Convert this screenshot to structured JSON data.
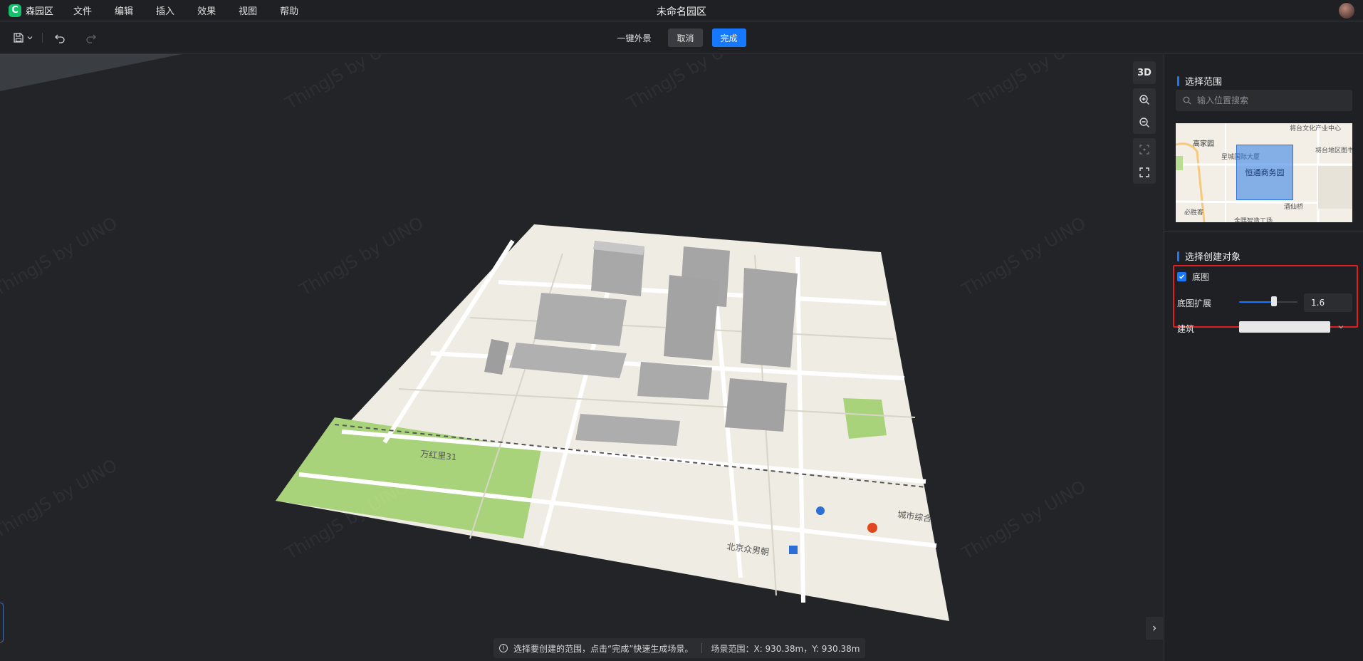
{
  "app": {
    "name": "森园区",
    "logo_letter": "C",
    "window_title": "未命名园区"
  },
  "menu": [
    "文件",
    "编辑",
    "插入",
    "效果",
    "视图",
    "帮助"
  ],
  "toolbar": {
    "one_click_label": "一键外景",
    "cancel_label": "取消",
    "done_label": "完成"
  },
  "viewport": {
    "view_mode_label": "3D",
    "watermark": "ThingJS by UINO",
    "status_hint": "选择要创建的范围，点击“完成”快速生成场景。",
    "scene_range": "场景范围：X: 930.38m，Y: 930.38m"
  },
  "panel": {
    "select_range_title": "选择范围",
    "search_placeholder": "输入位置搜索",
    "minimap_labels": {
      "gaojiayuan": "高家园",
      "road": "星城国际大厦",
      "culture": "将台文化产业中心",
      "area": "将台地区图书",
      "selected": "恒通商务园",
      "bottom1": "必胜客",
      "bottom2": "金隅智造工场",
      "bottom3": "酒仙桥"
    },
    "create_objects_title": "选择创建对象",
    "base_map": {
      "label": "底图",
      "checked": true
    },
    "base_map_extend": {
      "label": "底图扩展",
      "value": "1.6",
      "slider_fraction": 0.6
    },
    "building": {
      "label": "建筑"
    }
  },
  "colors": {
    "accent": "#1677ff",
    "highlight_box": "#e0201e",
    "background": "#232427"
  }
}
